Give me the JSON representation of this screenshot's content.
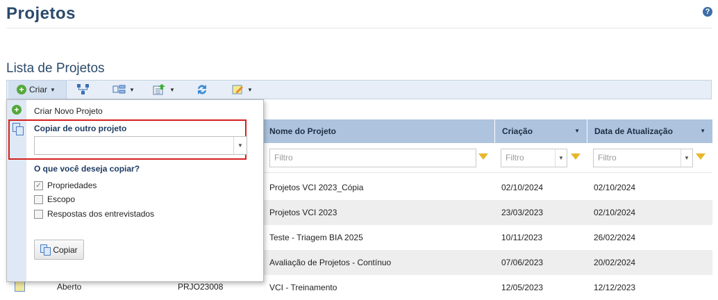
{
  "page": {
    "title": "Projetos",
    "help_icon": "?"
  },
  "section": {
    "title": "Lista de Projetos"
  },
  "toolbar": {
    "criar_label": "Criar",
    "icons": [
      "org-chart-icon",
      "tree-view-icon",
      "export-icon",
      "refresh-icon",
      "edit-icon"
    ]
  },
  "dropdown": {
    "new_project": "Criar Novo Projeto",
    "copy_from_label": "Copiar de outro projeto",
    "copy_from_value": "",
    "question": "O que você deseja copiar?",
    "options": [
      {
        "label": "Propriedades",
        "checked": true,
        "disabled": true
      },
      {
        "label": "Escopo",
        "checked": false
      },
      {
        "label": "Respostas dos entrevistados",
        "checked": false
      }
    ],
    "copy_button": "Copiar"
  },
  "table": {
    "columns": [
      "Nome do Projeto",
      "Criação",
      "Data de Atualização"
    ],
    "filter_placeholder": "Filtro",
    "rows": [
      {
        "name": "Projetos VCI 2023_Cópia",
        "created": "02/10/2024",
        "updated": "02/10/2024"
      },
      {
        "name": "Projetos VCI 2023",
        "created": "23/03/2023",
        "updated": "02/10/2024"
      },
      {
        "name": "Teste - Triagem BIA 2025",
        "created": "10/11/2023",
        "updated": "26/02/2024"
      },
      {
        "name": "Avaliação de Projetos - Contínuo",
        "created": "07/06/2023",
        "updated": "20/02/2024"
      },
      {
        "name": "VCI - Treinamento",
        "created": "12/05/2023",
        "updated": "12/12/2023"
      }
    ],
    "last_row_status": "Aberto",
    "last_row_code": "PRJO23008"
  },
  "colors": {
    "accent": "#2b4a6b",
    "highlight": "#d51f1f",
    "header": "#adc3de"
  }
}
